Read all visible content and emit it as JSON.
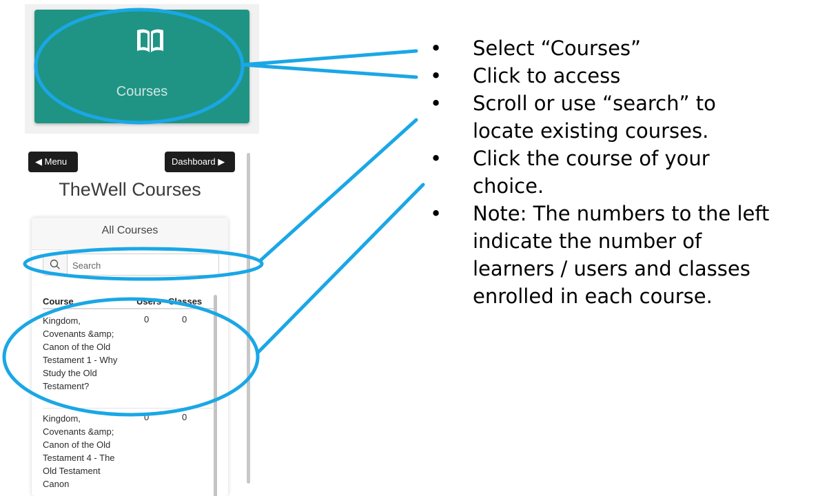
{
  "tile": {
    "label": "Courses",
    "icon": "book-open-icon",
    "color": "#1f9484"
  },
  "app": {
    "menu_button": "◀ Menu",
    "dashboard_button": "Dashboard ▶",
    "title": "TheWell Courses",
    "card_header": "All Courses",
    "search": {
      "placeholder": "Search",
      "value": ""
    },
    "table": {
      "headers": {
        "course": "Course",
        "users": "Users",
        "classes": "Classes"
      },
      "rows": [
        {
          "course_lines": [
            "Kingdom,",
            "Covenants &amp;",
            "Canon of the Old",
            "Testament 1 - Why",
            "Study the Old",
            "Testament?"
          ],
          "users": "0",
          "classes": "0"
        },
        {
          "course_lines": [
            "Kingdom,",
            "Covenants &amp;",
            "Canon of the Old",
            "Testament 4 - The",
            "Old Testament",
            "Canon"
          ],
          "users": "0",
          "classes": "0"
        }
      ]
    }
  },
  "annotation_color": "#1aa7e6",
  "instructions": {
    "bullet": "•",
    "items": [
      [
        "Select “Courses”"
      ],
      [
        "Click to access"
      ],
      [
        "Scroll or use “search” to",
        "locate existing courses."
      ],
      [
        "Click the course of your",
        "choice."
      ],
      [
        "Note: The numbers to the left",
        "indicate the number of",
        "learners / users and classes",
        "enrolled in each course."
      ]
    ]
  }
}
